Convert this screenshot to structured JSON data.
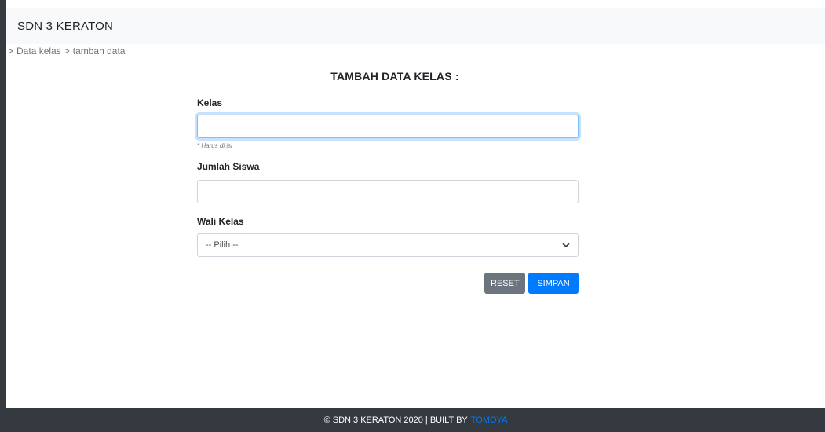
{
  "navbar": {
    "brand": "SDN 3 KERATON"
  },
  "breadcrumb": {
    "sep1": ">",
    "item1": "Data kelas",
    "sep2": ">",
    "item2": "tambah data"
  },
  "form": {
    "title": "TAMBAH DATA KELAS :",
    "kelas": {
      "label": "Kelas",
      "value": "",
      "placeholder": "",
      "hint": "* Harus di isi"
    },
    "jumlah_siswa": {
      "label": "Jumlah Siswa",
      "value": "",
      "placeholder": ""
    },
    "wali_kelas": {
      "label": "Wali Kelas",
      "selected": "-- Pilih --",
      "icon": "chevron-down-icon"
    },
    "buttons": {
      "reset": "RESET",
      "simpan": "SIMPAN"
    }
  },
  "footer": {
    "text": "© SDN 3 KERATON 2020 | BUILT BY",
    "author": "TOMOYA"
  },
  "colors": {
    "primary": "#007bff",
    "secondary": "#6c757d",
    "dark": "#343a40",
    "navbar_bg": "#f8f9fa"
  }
}
